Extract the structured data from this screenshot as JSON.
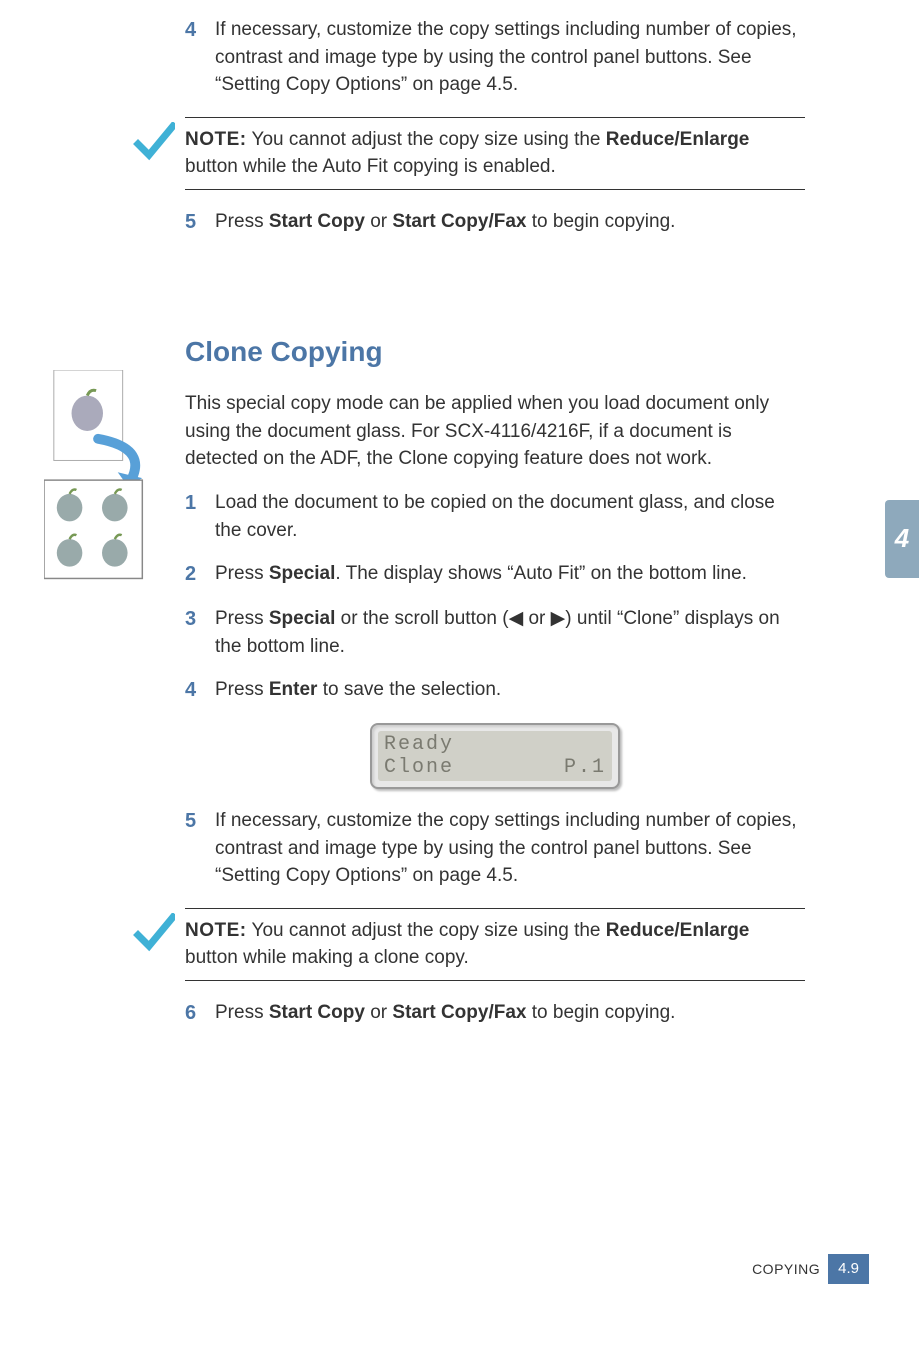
{
  "top": {
    "step4_num": "4",
    "step4_text_a": "If necessary, customize the copy settings including number of copies, contrast and image type by using the control panel buttons. See “Setting Copy Options” on page 4.5.",
    "note_label": "NOTE:",
    "note_text_a": " You cannot adjust the copy size using the ",
    "note_bold": "Reduce/Enlarge",
    "note_text_b": " button while the Auto Fit copying is enabled.",
    "step5_num": "5",
    "step5_a": "Press ",
    "step5_b1": "Start Copy",
    "step5_or": " or ",
    "step5_b2": "Start Copy/Fax",
    "step5_c": " to begin copying."
  },
  "heading": "Clone Copying",
  "intro": "This special copy mode can be applied when you load document only using the document glass. For SCX-4116/4216F, if a document is detected on the ADF, the Clone copying feature does not work.",
  "clone": {
    "s1_num": "1",
    "s1_text": "Load the document to be copied on the document glass, and close the cover.",
    "s2_num": "2",
    "s2_a": "Press ",
    "s2_b": "Special",
    "s2_c": ". The display shows “Auto Fit” on the bottom line.",
    "s3_num": "3",
    "s3_a": "Press ",
    "s3_b": "Special",
    "s3_c": " or the scroll button (◀ or ▶) until “Clone” displays on the bottom line.",
    "s4_num": "4",
    "s4_a": "Press ",
    "s4_b": "Enter",
    "s4_c": " to save the selection.",
    "lcd_line1": "Ready",
    "lcd_line2_left": "Clone",
    "lcd_line2_right": "P.1",
    "s5_num": "5",
    "s5_text": "If necessary, customize the copy settings including number of copies, contrast and image type by using the control panel buttons. See “Setting Copy Options” on page 4.5.",
    "note_label": "NOTE:",
    "note_a": " You cannot adjust the copy size using the ",
    "note_bold": "Reduce/Enlarge",
    "note_b": " button while making a clone copy.",
    "s6_num": "6",
    "s6_a": "Press ",
    "s6_b1": "Start Copy",
    "s6_or": " or ",
    "s6_b2": "Start Copy/Fax",
    "s6_c": " to begin copying."
  },
  "tab": "4",
  "footer": {
    "label": "COPYING",
    "page": "4.9"
  }
}
